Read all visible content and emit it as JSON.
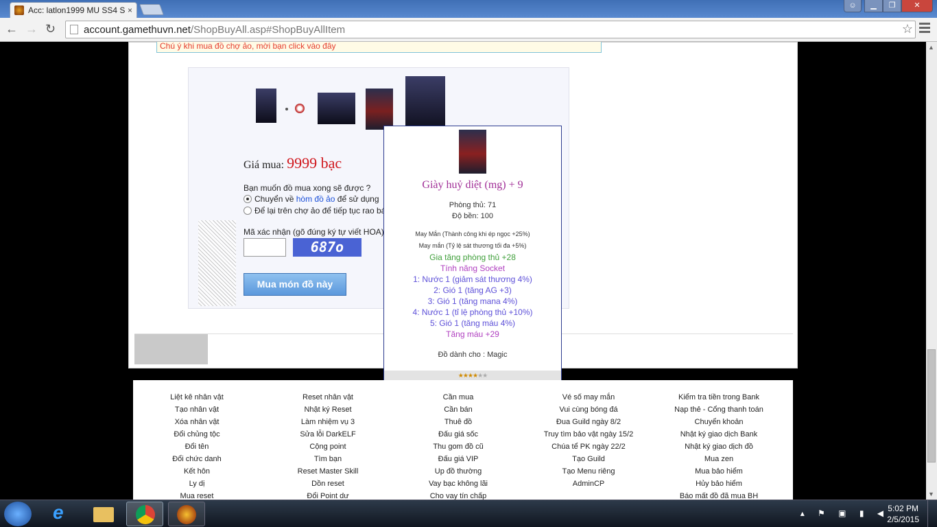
{
  "browser": {
    "tab_title": "Acc: latlon1999 MU SS4 S",
    "tab_close": "×",
    "url_host": "account.gamethuvn.net",
    "url_path": "/ShopBuyAll.asp#ShopBuyAllItem"
  },
  "page": {
    "notice": "Chú ý khi mua đồ chợ ảo, mời bạn click vào đây",
    "price_label": "Giá mua:",
    "price_value": "9999 bạc",
    "question": "Bạn muốn đồ mua xong sẽ được ?",
    "option1_prefix": "Chuyển về ",
    "option1_link": "hòm đồ ảo",
    "option1_suffix": " để sử dụng",
    "option2": "Để lại trên chợ ảo để tiếp tục rao bán",
    "captcha_label": "Mã xác nhận (gõ đúng ký tự viết HOA)",
    "captcha_code": "687o",
    "buy_button": "Mua món đồ này"
  },
  "tooltip": {
    "item_name": "Giày huỷ diệt (mg) + 9",
    "defense": "Phòng thủ: 71",
    "durability": "Độ bền: 100",
    "luck1": "May Mắn (Thành công khi ép ngọc +25%)",
    "luck2": "May mắn (Tỷ lệ sát thương tối đa +5%)",
    "option_add": "Gia tăng phòng thủ +28",
    "socket_title": "Tính năng Socket",
    "socket1": "1: Nước 1 (giảm sát thương 4%)",
    "socket2": "2: Gió 1 (tăng AG +3)",
    "socket3": "3: Gió 1 (tăng mana 4%)",
    "socket4": "4: Nước 1 (tỉ lệ phòng thủ +10%)",
    "socket5": "5: Gió 1 (tăng máu 4%)",
    "bonus": "Tăng máu +29",
    "owner": "Đồ dành cho : Magic",
    "rating_filled": "★★★★",
    "rating_empty": "★★",
    "rating_value": 4,
    "rating_max": 6
  },
  "footer": {
    "col1": [
      "Liệt kê nhân vật",
      "Tạo nhân vật",
      "Xóa nhân vật",
      "Đổi chủng tộc",
      "Đổi tên",
      "Đổi chức danh",
      "Kết hôn",
      "Ly dị",
      "Mua reset"
    ],
    "col2": [
      "Reset nhân vật",
      "Nhật ký Reset",
      "Làm nhiệm vụ 3",
      "Sửa lỗi DarkELF",
      "Cộng point",
      "Tìm bạn",
      "Reset Master Skill",
      "Dồn reset",
      "Đổi Point dư"
    ],
    "col3": [
      "Cần mua",
      "Cần bán",
      "Thuê đồ",
      "Đấu giá sốc",
      "Thu gom đồ cũ",
      "Đấu giá VIP",
      "Up đồ thường",
      "Vay bạc không lãi",
      "Cho vay tín chấp"
    ],
    "col4": [
      "Vé số may mắn",
      "Vui cùng bóng đá",
      "Đua Guild ngày 8/2",
      "Truy tìm bảo vật ngày 15/2",
      "Chúa tể PK ngày 22/2",
      "Tạo Guild",
      "Tạo Menu riêng",
      "AdminCP"
    ],
    "col5": [
      "Kiểm tra tiền trong Bank",
      "Nạp thẻ - Cổng thanh toán",
      "Chuyển khoản",
      "Nhật ký giao dịch Bank",
      "Nhật ký giao dịch đồ",
      "Mua zen",
      "Mua bảo hiểm",
      "Hủy bảo hiểm",
      "Báo mất đồ đã mua BH"
    ]
  },
  "taskbar": {
    "time": "5:02 PM",
    "date": "2/5/2015"
  }
}
